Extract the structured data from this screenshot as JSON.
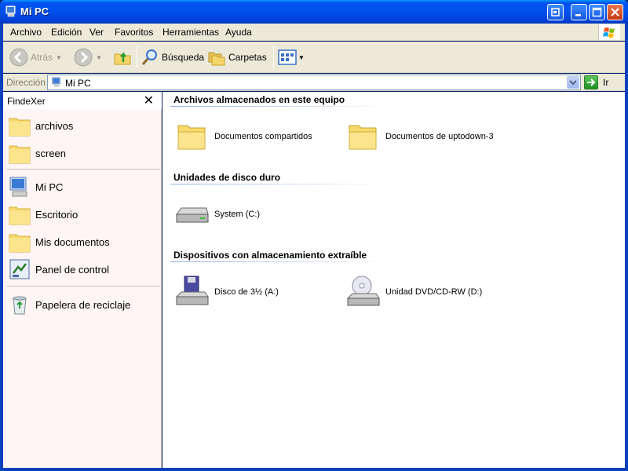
{
  "window": {
    "title": "Mi PC",
    "controls": [
      "restore",
      "minimize",
      "maximize",
      "close"
    ]
  },
  "menubar": {
    "items": [
      "Archivo",
      "Edición",
      "Ver",
      "Favoritos",
      "Herramientas",
      "Ayuda"
    ]
  },
  "toolbar": {
    "back_label": "Atrás",
    "search_label": "Búsqueda",
    "folders_label": "Carpetas"
  },
  "addressbar": {
    "label": "Dirección",
    "value": "Mi PC",
    "go_label": "Ir"
  },
  "left_panel": {
    "title": "FindeXer",
    "items": [
      {
        "label": "archivos",
        "icon": "folder-icon"
      },
      {
        "label": "screen",
        "icon": "folder-icon"
      },
      {
        "label": "Mi PC",
        "icon": "my-computer-icon"
      },
      {
        "label": "Escritorio",
        "icon": "folder-icon"
      },
      {
        "label": "Mis documentos",
        "icon": "folder-icon"
      },
      {
        "label": "Panel de control",
        "icon": "control-panel-icon"
      },
      {
        "label": "Papelera de reciclaje",
        "icon": "recycle-bin-icon"
      }
    ]
  },
  "main": {
    "groups": [
      {
        "title": "Archivos almacenados en este equipo",
        "items": [
          {
            "label": "Documentos compartidos",
            "icon": "folder-icon"
          },
          {
            "label": "Documentos de uptodown-3",
            "icon": "folder-icon"
          }
        ]
      },
      {
        "title": "Unidades de disco duro",
        "items": [
          {
            "label": "System (C:)",
            "icon": "hard-drive-icon"
          }
        ]
      },
      {
        "title": "Dispositivos con almacenamiento extraíble",
        "items": [
          {
            "label": "Disco de 3½ (A:)",
            "icon": "floppy-drive-icon"
          },
          {
            "label": "Unidad DVD/CD-RW (D:)",
            "icon": "dvd-drive-icon"
          }
        ]
      }
    ]
  },
  "colors": {
    "titlebar": "#0053EE",
    "chrome": "#ECE9D8",
    "left_panel_bg": "#FEF5F4",
    "group_line": "#8FB0E9"
  }
}
